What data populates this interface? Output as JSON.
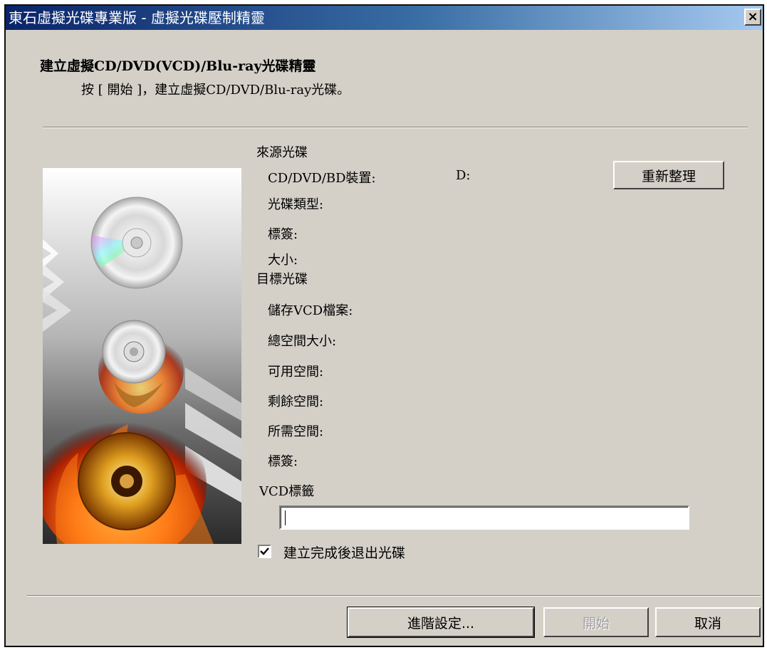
{
  "window": {
    "title": "東石虛擬光碟專業版 - 虛擬光碟壓制精靈",
    "close_glyph": "×"
  },
  "header": {
    "heading": "建立虛擬CD/DVD(VCD)/Blu-ray光碟精靈",
    "subheading": "按 [ 開始 ]，建立虛擬CD/DVD/Blu-ray光碟。"
  },
  "source": {
    "section_label": "來源光碟",
    "device_label": "CD/DVD/BD裝置:",
    "device_value": "D:",
    "disc_type_label": "光碟類型:",
    "label_label": "標簽:",
    "size_label": "大小:",
    "refresh_button": "重新整理"
  },
  "target": {
    "section_label": "目標光碟",
    "save_vcd_label": "儲存VCD檔案:",
    "total_space_label": "總空間大小:",
    "free_space_label": "可用空間:",
    "remaining_space_label": "剩餘空間:",
    "required_space_label": "所需空間:",
    "label_label": "標簽:"
  },
  "vcd_label": {
    "label": "VCD標籤",
    "value": ""
  },
  "eject": {
    "label": "建立完成後退出光碟",
    "checked": true
  },
  "buttons": {
    "advanced": "進階設定...",
    "start": "開始",
    "cancel": "取消"
  },
  "colors": {
    "dialog_bg": "#d4d0c8",
    "title_start": "#0a246a",
    "title_end": "#a6caf0"
  }
}
